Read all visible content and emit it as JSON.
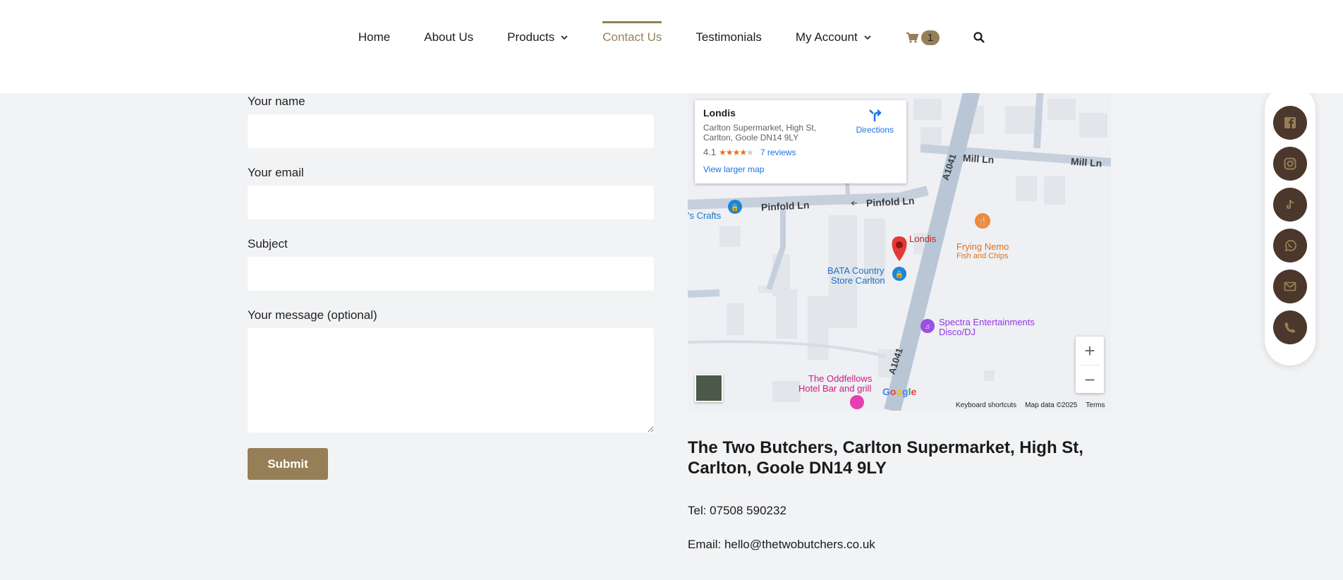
{
  "nav": {
    "items": [
      {
        "label": "Home"
      },
      {
        "label": "About Us"
      },
      {
        "label": "Products"
      },
      {
        "label": "Contact Us"
      },
      {
        "label": "Testimonials"
      },
      {
        "label": "My Account"
      }
    ],
    "cart_count": "1",
    "active_color": "#967f57"
  },
  "form": {
    "name_label": "Your name",
    "email_label": "Your email",
    "subject_label": "Subject",
    "message_label": "Your message (optional)",
    "submit_label": "Submit"
  },
  "map": {
    "place_name": "Londis",
    "place_address": "Carlton Supermarket, High St, Carlton, Goole DN14 9LY",
    "rating": "4.1",
    "reviews": "7 reviews",
    "view_larger": "View larger map",
    "directions": "Directions",
    "labels": {
      "pinfold_left": "Pinfold Ln",
      "pinfold_right": "Pinfold Ln",
      "mill1": "Mill Ln",
      "mill2": "Mill Ln",
      "a1041_top": "A1041",
      "a1041_bottom": "A1041",
      "crafts": "'s Crafts",
      "londis": "Londis",
      "frying_nemo": "Frying Nemo",
      "fish_chips": "Fish and Chips",
      "bata1": "BATA Country",
      "bata2": "Store Carlton",
      "spectra1": "Spectra Entertainments",
      "spectra2": "Disco/DJ",
      "odd1": "The Oddfellows",
      "odd2": "Hotel Bar and grill"
    },
    "google": "Google",
    "keyboard": "Keyboard shortcuts",
    "map_data": "Map data ©2025",
    "terms": "Terms"
  },
  "contact": {
    "address": "The Two Butchers, Carlton Supermarket, High St, Carlton, Goole DN14 9LY",
    "tel": "Tel: 07508 590232",
    "email": "Email: hello@thetwobutchers.co.uk"
  },
  "social": {
    "icons": [
      "facebook-icon",
      "instagram-icon",
      "tiktok-icon",
      "whatsapp-icon",
      "mail-icon",
      "phone-icon"
    ],
    "color": "#4b372b",
    "icon_color": "#967f57"
  }
}
